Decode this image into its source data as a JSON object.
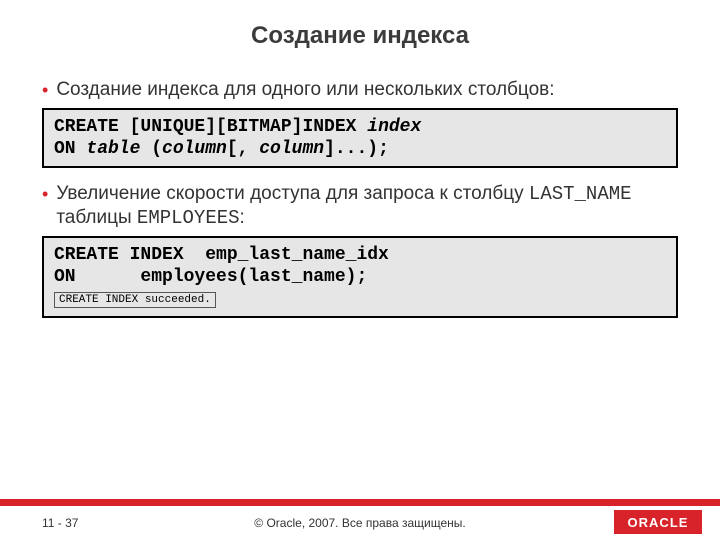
{
  "title": "Создание индекса",
  "bullets": {
    "b1": "Создание индекса для одного или нескольких столбцов:",
    "b2_pre": "Увеличение скорости доступа для запроса к столбцу ",
    "b2_code1": "LAST_NAME",
    "b2_mid": " таблицы ",
    "b2_code2": "EMPLOYEES",
    "b2_post": ":"
  },
  "code1": {
    "l1a": "CREATE [UNIQUE][BITMAP]INDEX ",
    "l1b": "index",
    "l2a": "ON ",
    "l2b": "table",
    "l2c": " (",
    "l2d": "column",
    "l2e": "[, ",
    "l2f": "column",
    "l2g": "]...);"
  },
  "code2": {
    "l1": "CREATE INDEX  emp_last_name_idx",
    "l2": "ON      employees(last_name);",
    "msg": "CREATE INDEX succeeded."
  },
  "footer": {
    "page": "11 - 37",
    "copyright": "© Oracle, 2007. Все права защищены.",
    "logo": "ORACLE"
  }
}
